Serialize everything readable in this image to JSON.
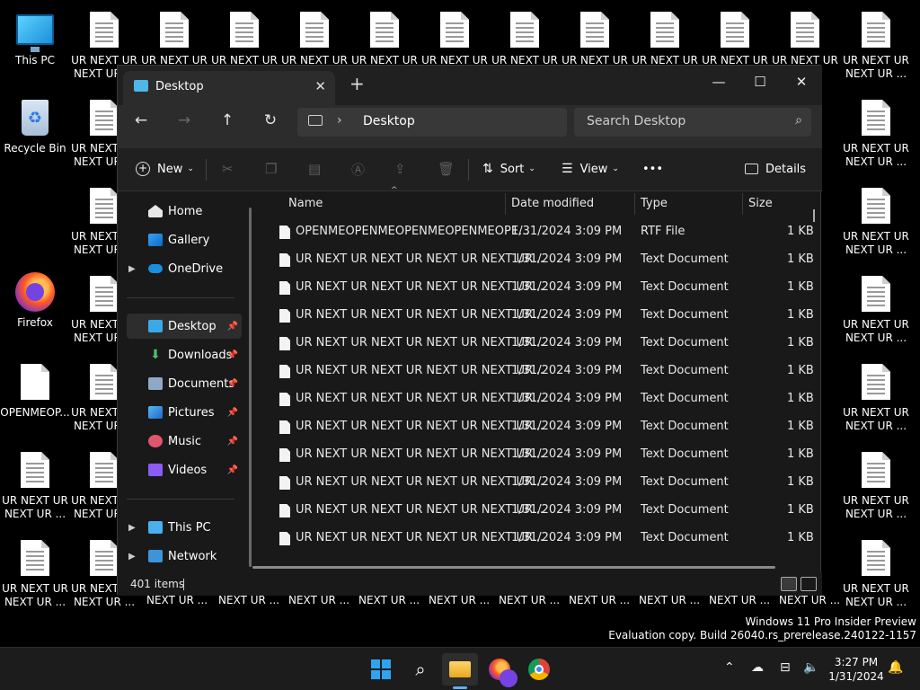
{
  "desktop": {
    "this_pc": "This PC",
    "recycle_bin": "Recycle Bin",
    "firefox": "Firefox",
    "openme": "OPENMEOP...",
    "tile_top": "UR NEXT UR",
    "tile_bottom": "NEXT UR ...",
    "tile_full": "UR NEXT UR NEXT UR ...",
    "bottom_strip": "NEXT UR ..."
  },
  "window": {
    "tab_title": "Desktop",
    "tab_close": "✕",
    "new_tab": "+",
    "minimize": "—",
    "maximize": "☐",
    "close": "✕",
    "nav": {
      "back": "←",
      "forward": "→",
      "up": "↑",
      "refresh": "↻"
    },
    "address_chevron": "›",
    "address_path": "Desktop",
    "search_placeholder": "Search Desktop",
    "commands": {
      "new": "New",
      "sort": "Sort",
      "view": "View",
      "more": "•••",
      "details": "Details"
    },
    "sidebar": {
      "home": "Home",
      "gallery": "Gallery",
      "onedrive": "OneDrive",
      "desktop": "Desktop",
      "downloads": "Downloads",
      "documents": "Documents",
      "pictures": "Pictures",
      "music": "Music",
      "videos": "Videos",
      "this_pc": "This PC",
      "network": "Network"
    },
    "columns": {
      "name": "Name",
      "date": "Date modified",
      "type": "Type",
      "size": "Size"
    },
    "files": [
      {
        "name": "OPENMEOPENMEOPENMEOPENMEOPE...",
        "date": "1/31/2024 3:09 PM",
        "type": "RTF File",
        "size": "1 KB"
      },
      {
        "name": "UR NEXT UR NEXT UR NEXT UR NEXT UR...",
        "date": "1/31/2024 3:09 PM",
        "type": "Text Document",
        "size": "1 KB"
      },
      {
        "name": "UR NEXT UR NEXT UR NEXT UR NEXT UR...",
        "date": "1/31/2024 3:09 PM",
        "type": "Text Document",
        "size": "1 KB"
      },
      {
        "name": "UR NEXT UR NEXT UR NEXT UR NEXT UR...",
        "date": "1/31/2024 3:09 PM",
        "type": "Text Document",
        "size": "1 KB"
      },
      {
        "name": "UR NEXT UR NEXT UR NEXT UR NEXT UR...",
        "date": "1/31/2024 3:09 PM",
        "type": "Text Document",
        "size": "1 KB"
      },
      {
        "name": "UR NEXT UR NEXT UR NEXT UR NEXT UR...",
        "date": "1/31/2024 3:09 PM",
        "type": "Text Document",
        "size": "1 KB"
      },
      {
        "name": "UR NEXT UR NEXT UR NEXT UR NEXT UR...",
        "date": "1/31/2024 3:09 PM",
        "type": "Text Document",
        "size": "1 KB"
      },
      {
        "name": "UR NEXT UR NEXT UR NEXT UR NEXT UR...",
        "date": "1/31/2024 3:09 PM",
        "type": "Text Document",
        "size": "1 KB"
      },
      {
        "name": "UR NEXT UR NEXT UR NEXT UR NEXT UR...",
        "date": "1/31/2024 3:09 PM",
        "type": "Text Document",
        "size": "1 KB"
      },
      {
        "name": "UR NEXT UR NEXT UR NEXT UR NEXT UR...",
        "date": "1/31/2024 3:09 PM",
        "type": "Text Document",
        "size": "1 KB"
      },
      {
        "name": "UR NEXT UR NEXT UR NEXT UR NEXT UR...",
        "date": "1/31/2024 3:09 PM",
        "type": "Text Document",
        "size": "1 KB"
      },
      {
        "name": "UR NEXT UR NEXT UR NEXT UR NEXT UR...",
        "date": "1/31/2024 3:09 PM",
        "type": "Text Document",
        "size": "1 KB"
      }
    ],
    "status": "401 items"
  },
  "watermark": {
    "line1": "Windows 11 Pro Insider Preview",
    "line2": "Evaluation copy. Build 26040.rs_prerelease.240122-1157"
  },
  "taskbar": {
    "time": "3:27 PM",
    "date": "1/31/2024"
  }
}
